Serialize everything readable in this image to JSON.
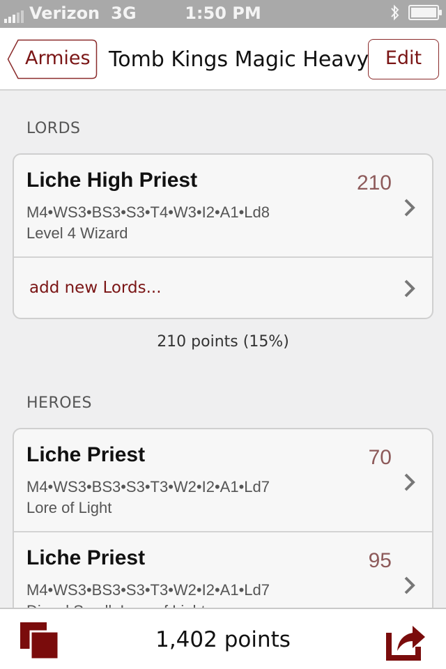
{
  "status_bar": {
    "carrier": "Verizon",
    "network": "3G",
    "time": "1:50 PM"
  },
  "nav": {
    "back_label": "Armies",
    "title": "Tomb Kings Magic Heavy",
    "edit_label": "Edit"
  },
  "sections": [
    {
      "header": "LORDS",
      "units": [
        {
          "name": "Liche High Priest",
          "points": "210",
          "stats": "M4•WS3•BS3•S3•T4•W3•I2•A1•Ld8",
          "note": "Level 4 Wizard"
        }
      ],
      "add_label": "add new Lords...",
      "total": "210 points (15%)"
    },
    {
      "header": "HEROES",
      "units": [
        {
          "name": "Liche Priest",
          "points": "70",
          "stats": "M4•WS3•BS3•S3•T3•W2•I2•A1•Ld7",
          "note": "Lore of Light"
        },
        {
          "name": "Liche Priest",
          "points": "95",
          "stats": "M4•WS3•BS3•S3•T3•W2•I2•A1•Ld7",
          "note": "Dispel Scroll; Lore of Light"
        }
      ]
    }
  ],
  "toolbar": {
    "total_points": "1,402 points"
  },
  "colors": {
    "accent": "#7a1515",
    "points": "#8d5a5a",
    "icon": "#7a0c0c"
  }
}
